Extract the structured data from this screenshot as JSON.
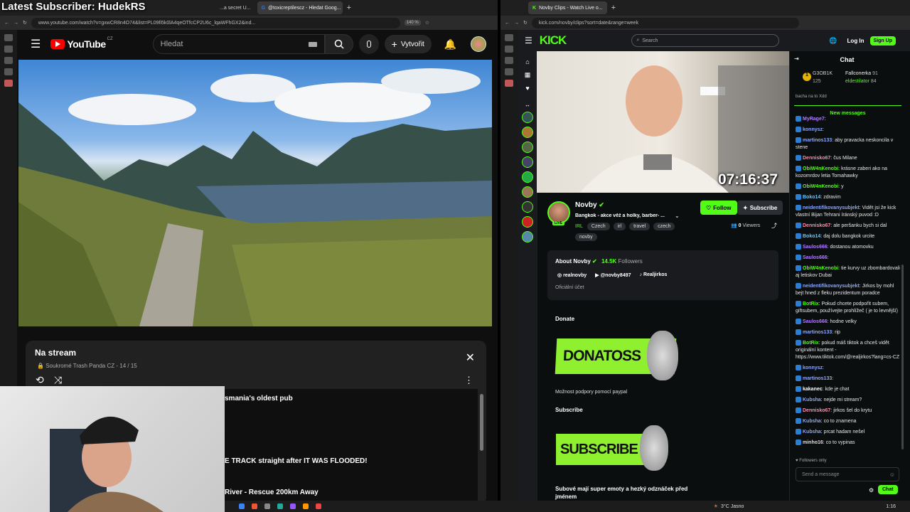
{
  "overlay_title": "Latest Subscriber: HudekRS",
  "left_browser": {
    "tabs": [
      "...a secret U...",
      "@toxicreptilescz - Hledat Goog..."
    ],
    "new_tab": "+",
    "url": "www.youtube.com/watch?v=gxwCR8n4O74&list=PL09fi5k0lA4qeOTfcCP2U6c_lqaWFhGX2&ind...",
    "zoom": "140 %"
  },
  "youtube": {
    "logo": "YouTube",
    "region": "CZ",
    "search_placeholder": "Hledat",
    "create_label": "Vytvořit",
    "playlist": {
      "title": "Na stream",
      "meta": "Soukromé",
      "owner": "Trash Panda CZ",
      "position": "14 / 15",
      "items": [
        "smania's oldest pub",
        "E TRACK straight after IT WAS FLOODED!",
        "River - Rescue 200km Away"
      ]
    }
  },
  "right_browser": {
    "tab": "Novby Clips - Watch Live o...",
    "new_tab": "+",
    "url": "kick.com/novby/clips?sort=date&range=week"
  },
  "kick": {
    "logo": "KICK",
    "search_placeholder": "Search",
    "login": "Log In",
    "signup": "Sign Up",
    "timer": "07:16:37",
    "streamer": {
      "name": "Novby",
      "live": "LIVE",
      "title": "Bangkok - akce věž a holky, barber- ...",
      "tags": [
        "IRL",
        "Czech",
        "irl",
        "travel",
        "czech",
        "novby"
      ],
      "follow": "Follow",
      "subscribe": "Subscribe",
      "viewers_count": "0",
      "viewers_label": "Viewers"
    },
    "about": {
      "heading": "About Novby",
      "followers_count": "14.5K",
      "followers_label": "Followers",
      "socials": [
        "realnovby",
        "@novby8497",
        "Realjirkos"
      ],
      "note": "Oficiální účet"
    },
    "panels": {
      "donate_heading": "Donate",
      "donate_banner": "DONATOSS",
      "donate_text": "Možnost podpory pomocí paypal",
      "subscribe_heading": "Subscribe",
      "subscribe_banner": "SUBSCRIBE",
      "subscribe_text": "Subové mají super emoty a hezký odznáček před jménem"
    },
    "chat": {
      "header": "Chat",
      "leaders": [
        {
          "name": "G3OB1K",
          "value": "125"
        },
        {
          "name": "Fallconerka",
          "value": "91"
        },
        {
          "name": "eldestilator",
          "value": "84"
        }
      ],
      "pinned_fragment": "bacha na to Xdd",
      "new_messages": "New messages",
      "messages": [
        {
          "user": "MyRage7",
          "text": "",
          "color": "#b07cff"
        },
        {
          "user": "konnysz",
          "text": "",
          "color": "#8aa7ff"
        },
        {
          "user": "martinos133",
          "text": "aby pravacka neskoncila v stene",
          "color": "#8aa7ff"
        },
        {
          "user": "Dennisko67",
          "text": "čus Milane",
          "color": "#ff8aa9"
        },
        {
          "user": "ObiW4nKenobi",
          "text": "krásne zaberi ako na kozomrdov letia Tomahawky",
          "color": "#53fc18"
        },
        {
          "user": "ObiW4nKenobi",
          "text": "y",
          "color": "#53fc18"
        },
        {
          "user": "Boko14",
          "text": "zdravim",
          "color": "#62c7ff"
        },
        {
          "user": "neidentifikovanysubjekt",
          "text": "Vidět jsi že kick vlastní Bijan Tehrani íránský puvod :D",
          "color": "#8aa7ff"
        },
        {
          "user": "Dennisko67",
          "text": "ale peršanku bych si dal",
          "color": "#ff8aa9"
        },
        {
          "user": "Boko14",
          "text": "daj dolu bangkok urcite",
          "color": "#62c7ff"
        },
        {
          "user": "Saulos666",
          "text": "dostanou atomovku",
          "color": "#b07cff"
        },
        {
          "user": "Saulos666",
          "text": "",
          "color": "#b07cff"
        },
        {
          "user": "ObiW4nKenobi",
          "text": "tie kurvy uz zbombardovali aj letiskov Dubai",
          "color": "#53fc18"
        },
        {
          "user": "neidentifikovanysubjekt",
          "text": "Jirkos by mohl bejt hned z fleku prezidentum poradce",
          "color": "#8aa7ff"
        },
        {
          "user": "BotRix",
          "text": "Pokud chcete podpořit subem, giftsubem, používejte prohlížeč ( je to levnější)",
          "color": "#53fc18"
        },
        {
          "user": "Saulos666",
          "text": "hodne velky",
          "color": "#b07cff"
        },
        {
          "user": "martinos133",
          "text": "rip",
          "color": "#8aa7ff"
        },
        {
          "user": "BotRix",
          "text": "pokud máš tiktok a chceš vidět originální kontent - https://www.tiktok.com/@realjirkos?lang=cs-CZ",
          "color": "#53fc18"
        },
        {
          "user": "konnysz",
          "text": "",
          "color": "#8aa7ff"
        },
        {
          "user": "martinos133",
          "text": "",
          "color": "#8aa7ff"
        },
        {
          "user": "kakanec",
          "text": "kde je chat",
          "color": "#ffffff"
        },
        {
          "user": "Kubsha",
          "text": "nejde mi stream?",
          "color": "#8aa7ff"
        },
        {
          "user": "Dennisko67",
          "text": "jirkos šel do krytu",
          "color": "#ff8aa9"
        },
        {
          "user": "Kubsha",
          "text": "co to znamena",
          "color": "#8aa7ff"
        },
        {
          "user": "Kubsha",
          "text": "prcat hadam nešel",
          "color": "#8aa7ff"
        },
        {
          "user": "minho16",
          "text": "co to vypinas",
          "color": "#dddddd"
        }
      ],
      "followers_only": "Followers only",
      "input_placeholder": "Send a message",
      "send": "Chat"
    }
  },
  "taskbar": {
    "weather": "3°C Jasno",
    "time": "1:16"
  },
  "colors": {
    "kick_green": "#53fc18",
    "yt_red": "#ff0000",
    "dark": "#0f0f0f"
  }
}
